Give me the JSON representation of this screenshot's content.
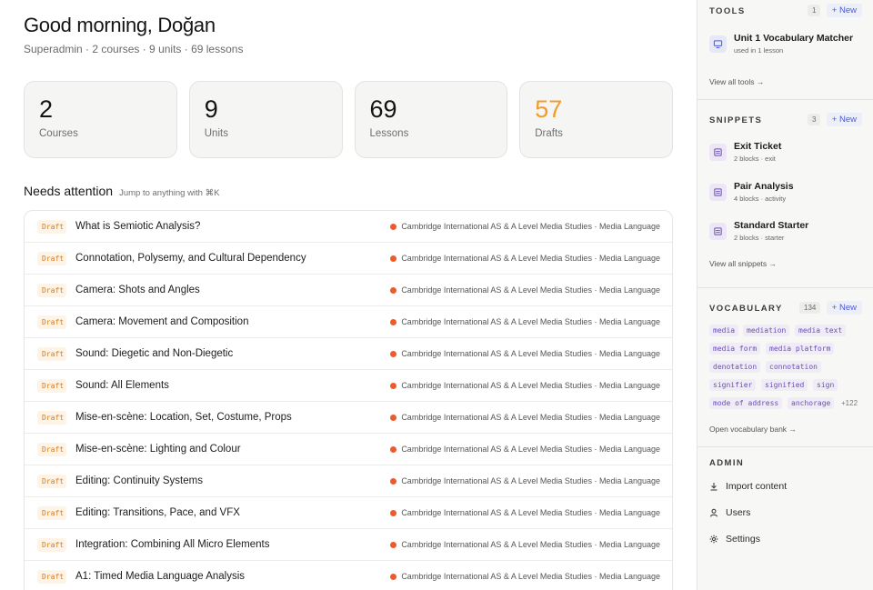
{
  "header": {
    "greeting": "Good morning, Doğan",
    "subtitle": "Superadmin · 2 courses · 9 units · 69 lessons"
  },
  "stats": [
    {
      "value": "2",
      "label": "Courses"
    },
    {
      "value": "9",
      "label": "Units"
    },
    {
      "value": "69",
      "label": "Lessons"
    },
    {
      "value": "57",
      "label": "Drafts"
    }
  ],
  "attention": {
    "title": "Needs attention",
    "hint": "Jump to anything with ⌘K",
    "rows": [
      {
        "status": "Draft",
        "title": "What is Semiotic Analysis?",
        "course": "Cambridge International AS & A Level Media Studies · Media Language"
      },
      {
        "status": "Draft",
        "title": "Connotation, Polysemy, and Cultural Dependency",
        "course": "Cambridge International AS & A Level Media Studies · Media Language"
      },
      {
        "status": "Draft",
        "title": "Camera: Shots and Angles",
        "course": "Cambridge International AS & A Level Media Studies · Media Language"
      },
      {
        "status": "Draft",
        "title": "Camera: Movement and Composition",
        "course": "Cambridge International AS & A Level Media Studies · Media Language"
      },
      {
        "status": "Draft",
        "title": "Sound: Diegetic and Non-Diegetic",
        "course": "Cambridge International AS & A Level Media Studies · Media Language"
      },
      {
        "status": "Draft",
        "title": "Sound: All Elements",
        "course": "Cambridge International AS & A Level Media Studies · Media Language"
      },
      {
        "status": "Draft",
        "title": "Mise-en-scène: Location, Set, Costume, Props",
        "course": "Cambridge International AS & A Level Media Studies · Media Language"
      },
      {
        "status": "Draft",
        "title": "Mise-en-scène: Lighting and Colour",
        "course": "Cambridge International AS & A Level Media Studies · Media Language"
      },
      {
        "status": "Draft",
        "title": "Editing: Continuity Systems",
        "course": "Cambridge International AS & A Level Media Studies · Media Language"
      },
      {
        "status": "Draft",
        "title": "Editing: Transitions, Pace, and VFX",
        "course": "Cambridge International AS & A Level Media Studies · Media Language"
      },
      {
        "status": "Draft",
        "title": "Integration: Combining All Micro Elements",
        "course": "Cambridge International AS & A Level Media Studies · Media Language"
      },
      {
        "status": "Draft",
        "title": "A1: Timed Media Language Analysis",
        "course": "Cambridge International AS & A Level Media Studies · Media Language"
      }
    ]
  },
  "tools": {
    "title": "TOOLS",
    "count": "1",
    "new_label": "+ New",
    "items": [
      {
        "name": "Unit 1 Vocabulary Matcher",
        "sub": "used in 1 lesson",
        "icon": "monitor-icon"
      }
    ],
    "view_all": "View all tools →"
  },
  "snippets": {
    "title": "SNIPPETS",
    "count": "3",
    "new_label": "+ New",
    "items": [
      {
        "name": "Exit Ticket",
        "sub": "2 blocks · exit",
        "icon": "stack-icon"
      },
      {
        "name": "Pair Analysis",
        "sub": "4 blocks · activity",
        "icon": "stack-icon"
      },
      {
        "name": "Standard Starter",
        "sub": "2 blocks · starter",
        "icon": "stack-icon"
      }
    ],
    "view_all": "View all snippets →"
  },
  "vocabulary": {
    "title": "VOCABULARY",
    "count": "134",
    "new_label": "+ New",
    "terms": [
      "media",
      "mediation",
      "media text",
      "media form",
      "media platform",
      "denotation",
      "connotation",
      "signifier",
      "signified",
      "sign",
      "mode of address",
      "anchorage"
    ],
    "more": "+122",
    "open_bank": "Open vocabulary bank →"
  },
  "admin": {
    "title": "ADMIN",
    "items": [
      {
        "label": "Import content",
        "icon": "download-icon"
      },
      {
        "label": "Users",
        "icon": "user-icon"
      },
      {
        "label": "Settings",
        "icon": "gear-icon"
      }
    ]
  },
  "colors": {
    "draft_accent": "#f29b2b",
    "status_dot": "#ee5b2a",
    "link_blue": "#4a5bd8",
    "vocab_purple": "#6a4fb8"
  }
}
